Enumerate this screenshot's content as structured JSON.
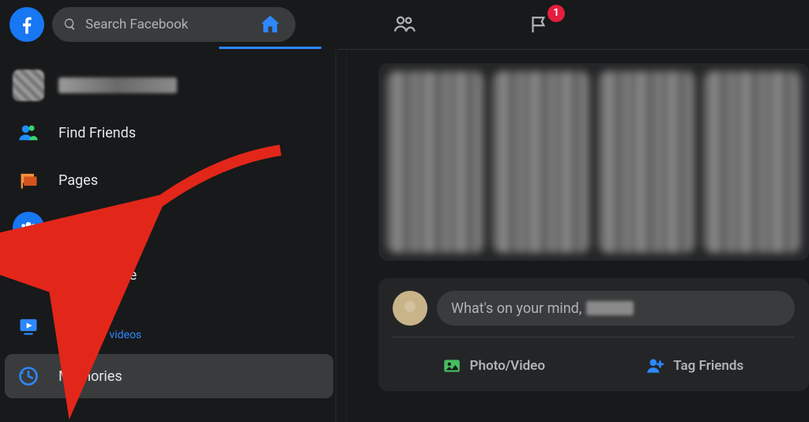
{
  "header": {
    "search_placeholder": "Search Facebook",
    "notifications_badge": "1"
  },
  "sidebar": {
    "items": [
      {
        "label": "",
        "type": "profile"
      },
      {
        "label": "Find Friends"
      },
      {
        "label": "Pages"
      },
      {
        "label": "Groups"
      },
      {
        "label": "Marketplace"
      },
      {
        "label": "Watch",
        "sublabel": "9+ new videos"
      },
      {
        "label": "Memories"
      }
    ]
  },
  "composer": {
    "placeholder_prefix": "What's on your mind,",
    "photo_video": "Photo/Video",
    "tag_friends": "Tag Friends"
  }
}
